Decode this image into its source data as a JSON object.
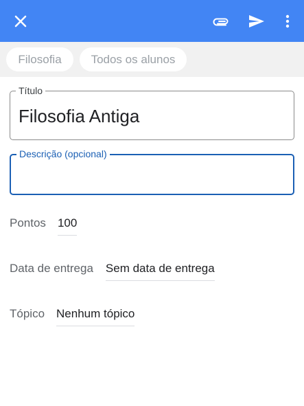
{
  "appbar": {
    "close_icon": "close-icon",
    "attach_icon": "paperclip-icon",
    "send_icon": "send-icon",
    "more_icon": "more-vert-icon",
    "color": "#4285f4"
  },
  "chips": {
    "class": "Filosofia",
    "students": "Todos os alunos"
  },
  "form": {
    "title_label": "Título",
    "title_value": "Filosofia Antiga",
    "description_label": "Descrição (opcional)",
    "description_value": "",
    "points_label": "Pontos",
    "points_value": "100",
    "due_label": "Data de entrega",
    "due_value": "Sem data de entrega",
    "topic_label": "Tópico",
    "topic_value": "Nenhum tópico"
  },
  "colors": {
    "accent": "#1a5fb4"
  }
}
